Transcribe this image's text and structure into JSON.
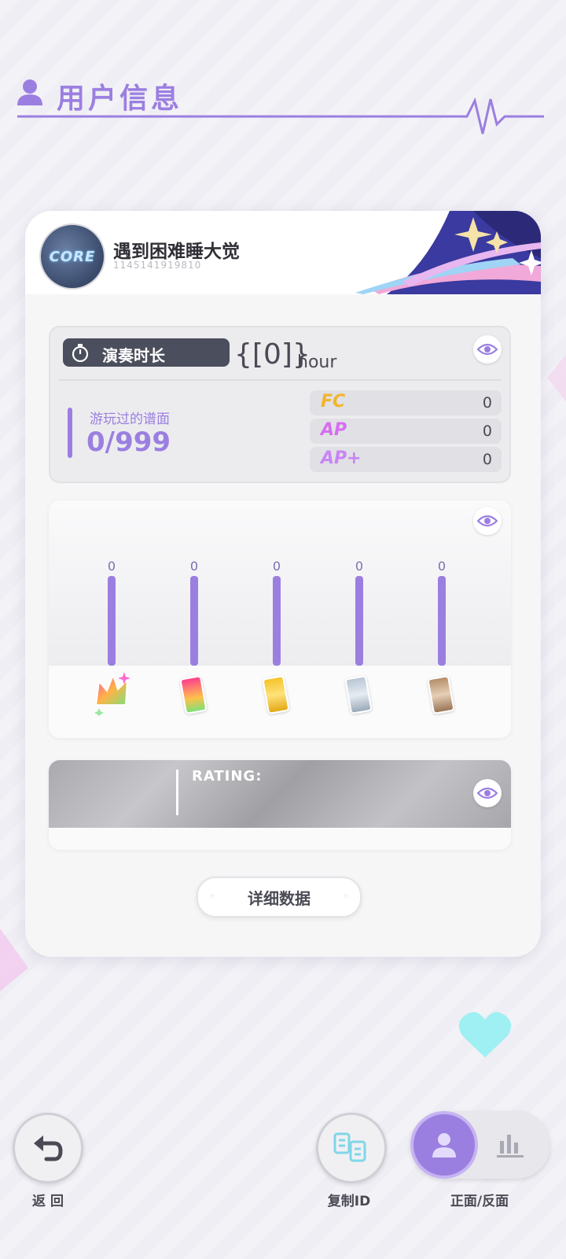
{
  "header": {
    "title": "用户信息",
    "icon": "user-icon",
    "accent": "#9b7fe0"
  },
  "profile": {
    "name": "遇到困难睡大觉",
    "uid": "1145141919810",
    "avatar_text": "CORE"
  },
  "stats": {
    "play_time_label": "演奏时长",
    "play_time_value": "{[0]}",
    "play_time_unit": "hour",
    "played_label": "游玩过的谱面",
    "played_value": "0/999",
    "rows": [
      {
        "name": "FC",
        "value": "0",
        "color": "#f2b52a"
      },
      {
        "name": "AP",
        "value": "0",
        "color": "#d56ef0"
      },
      {
        "name": "AP+",
        "value": "0",
        "color": "#c984f5"
      }
    ]
  },
  "difficulty_chart": {
    "values": [
      "0",
      "0",
      "0",
      "0",
      "0"
    ],
    "icons": [
      "rainbow-crown-icon",
      "pink-can-icon",
      "gold-can-icon",
      "silver-can-icon",
      "bronze-can-icon"
    ]
  },
  "rating": {
    "label": "RATING:"
  },
  "detail_button": {
    "label": "详细数据"
  },
  "bottom": {
    "back_label": "返 回",
    "copy_label": "复制ID",
    "toggle_label": "正面/反面"
  }
}
